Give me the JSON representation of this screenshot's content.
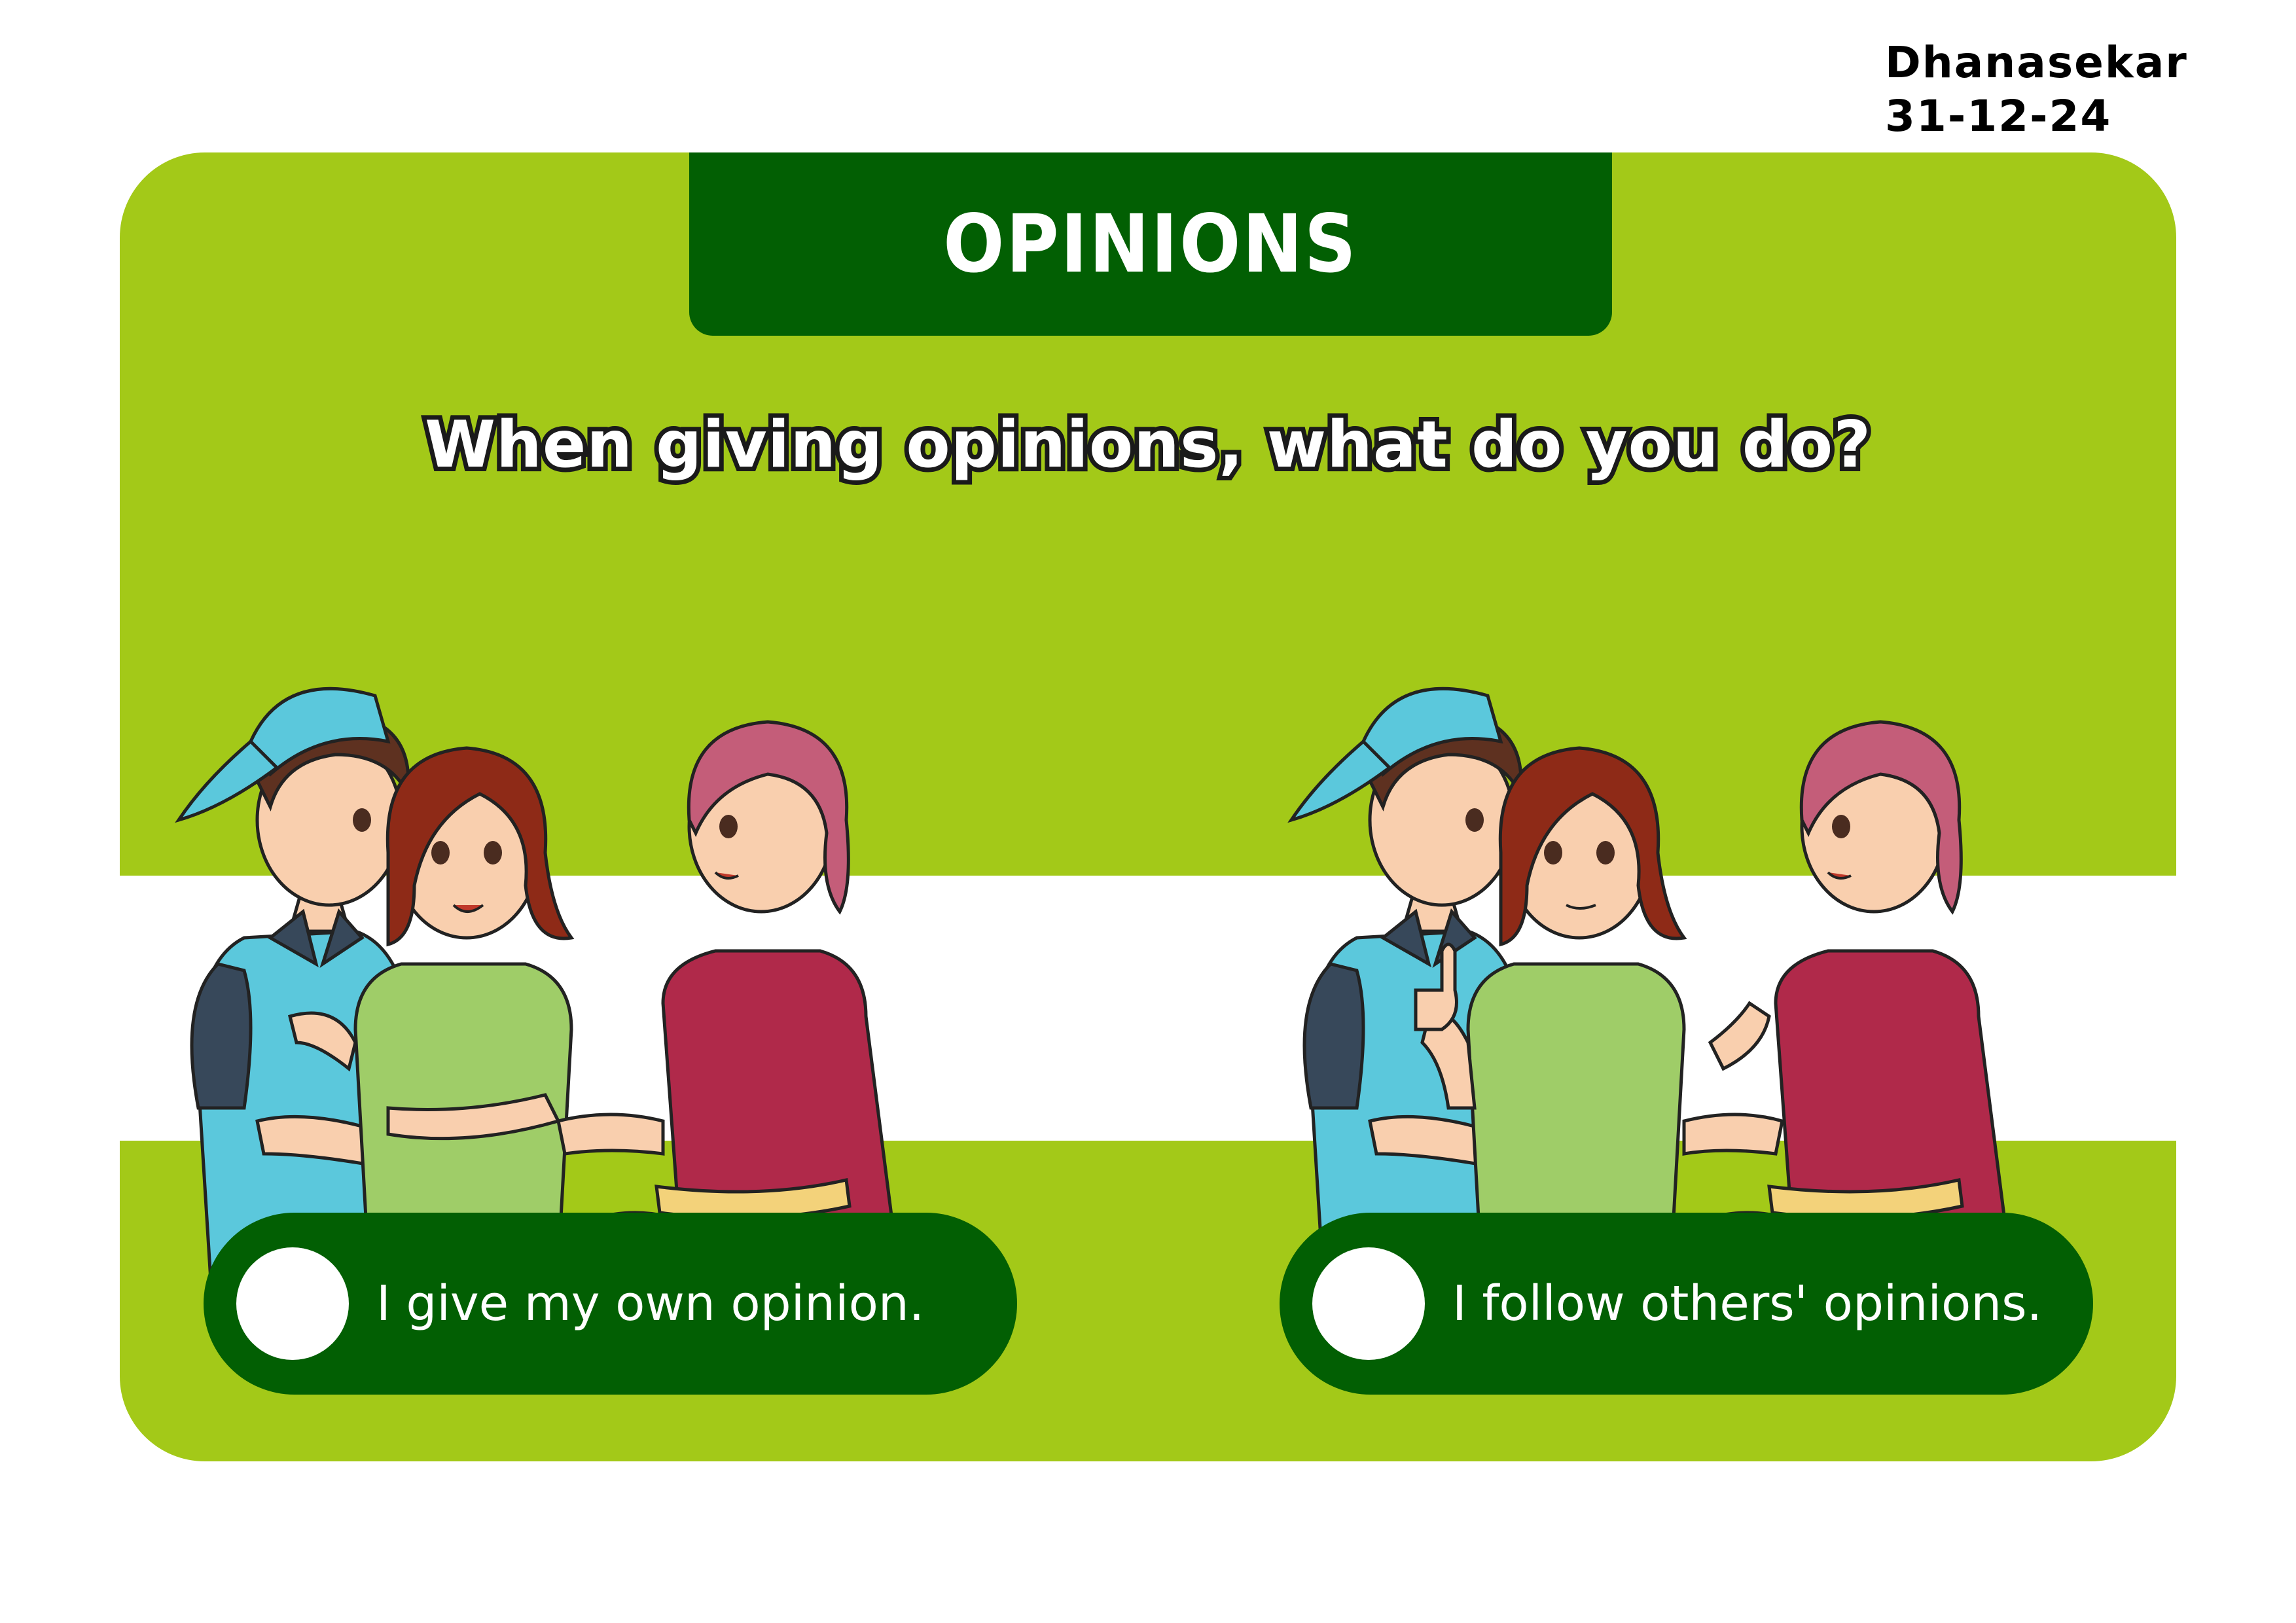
{
  "credit": {
    "author": "Dhanasekar",
    "date": "31-12-24"
  },
  "card": {
    "title": "OPINIONS",
    "question": "When giving opinions, what do you do?",
    "options": [
      {
        "label": "I give my own opinion.",
        "selected": false
      },
      {
        "label": "I follow others' opinions.",
        "selected": false
      }
    ]
  },
  "colors": {
    "card_background": "#a3c918",
    "dark_green": "#025f03",
    "band": "#ffffff",
    "boy_cap": "#5bc8dc",
    "boy_shirt": "#5bc8dc",
    "girl_shirt": "#9fcd68",
    "woman_top": "#b0294a",
    "belt": "#f3d27a"
  },
  "illustrations": [
    {
      "name": "three-friends-talking",
      "characters": [
        "boy-with-cap",
        "girl-green-shirt",
        "woman-red-top"
      ]
    },
    {
      "name": "three-friends-agreeing",
      "characters": [
        "boy-with-cap",
        "girl-green-shirt-thumbs-up",
        "woman-red-top"
      ]
    }
  ]
}
